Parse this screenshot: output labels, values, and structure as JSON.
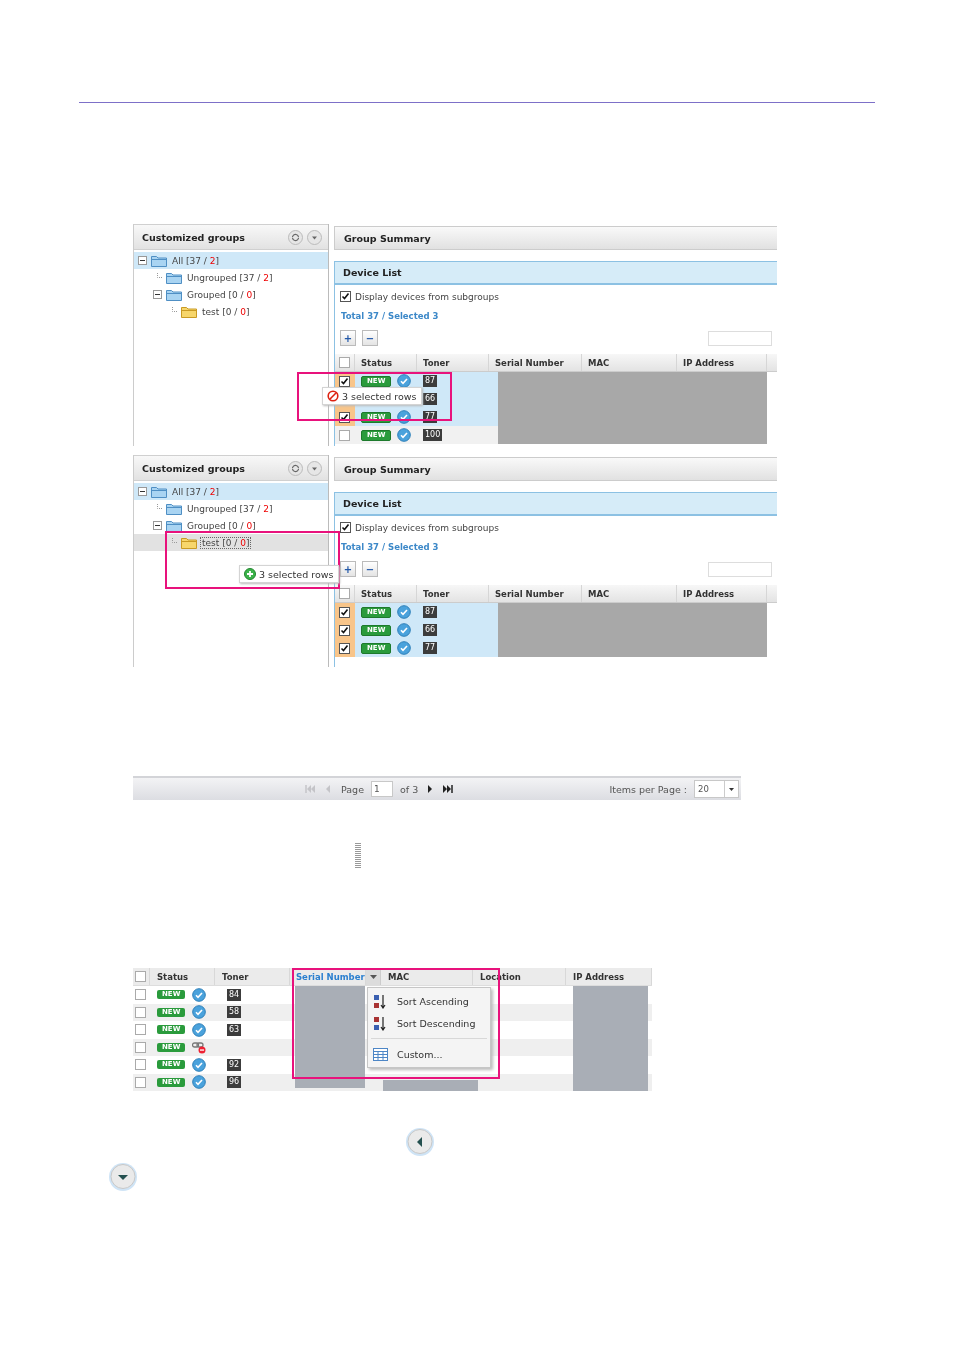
{
  "figures": [
    {
      "groups_title": "Customized groups",
      "tree": [
        {
          "text": "All [37 / ",
          "count": "2",
          "end": "]",
          "kind": "group",
          "selected": true,
          "drop_target": false,
          "expanded": true,
          "children": [
            {
              "text": "Ungrouped [37 / ",
              "count": "2",
              "end": "]",
              "kind": "group",
              "selected": false,
              "drop_target": false
            },
            {
              "text": "Grouped [0 / ",
              "count": "0",
              "end": "]",
              "kind": "group",
              "selected": false,
              "drop_target": false,
              "expanded": true,
              "children": [
                {
                  "text": "test [0 / ",
                  "count": "0",
                  "end": "]",
                  "kind": "leaf",
                  "selected": false,
                  "drop_target": false
                }
              ]
            }
          ]
        }
      ],
      "summary_title": "Group Summary",
      "list_title": "Device List",
      "subgroups": {
        "label": "Display devices from subgroups",
        "checked": true
      },
      "totals": "Total 37 / Selected 3",
      "toolbar": [
        "+",
        "−"
      ],
      "all_checked": false,
      "columns": [
        "Status",
        "Toner",
        "Serial Number",
        "MAC",
        "IP Address"
      ],
      "rows": [
        {
          "checked": true,
          "status": "NEW",
          "kind": "online",
          "toner": "87"
        },
        {
          "checked": true,
          "toner": "66"
        },
        {
          "checked": true,
          "status": "NEW",
          "kind": "online",
          "toner": "77"
        },
        {
          "checked": false,
          "status": "NEW",
          "kind": "online",
          "toner": "100"
        }
      ],
      "drag": {
        "text": "3 selected rows",
        "allowed": false
      }
    },
    {
      "groups_title": "Customized groups",
      "tree": [
        {
          "text": "All [37 / ",
          "count": "2",
          "end": "]",
          "kind": "group",
          "selected": true,
          "drop_target": false,
          "expanded": true,
          "children": [
            {
              "text": "Ungrouped [37 / ",
              "count": "2",
              "end": "]",
              "kind": "group",
              "selected": false,
              "drop_target": false
            },
            {
              "text": "Grouped [0 / ",
              "count": "0",
              "end": "]",
              "kind": "group",
              "selected": false,
              "drop_target": false,
              "expanded": true,
              "children": [
                {
                  "text": "test [0 / ",
                  "count": "0",
                  "end": "]",
                  "kind": "leaf",
                  "selected": false,
                  "drop_target": true
                }
              ]
            }
          ]
        }
      ],
      "summary_title": "Group Summary",
      "list_title": "Device List",
      "subgroups": {
        "label": "Display devices from subgroups",
        "checked": true
      },
      "totals": "Total 37 / Selected 3",
      "toolbar": [
        "+",
        "−"
      ],
      "all_checked": false,
      "columns": [
        "Status",
        "Toner",
        "Serial Number",
        "MAC",
        "IP Address"
      ],
      "rows": [
        {
          "checked": true,
          "status": "NEW",
          "kind": "online",
          "toner": "87"
        },
        {
          "checked": true,
          "status": "NEW",
          "kind": "online",
          "toner": "66"
        },
        {
          "checked": true,
          "status": "NEW",
          "kind": "online",
          "toner": "77"
        }
      ],
      "drag": {
        "text": "3 selected rows",
        "allowed": true
      }
    }
  ],
  "pager": {
    "nav_back": [
      {
        "kind": "first",
        "disabled": true
      },
      {
        "kind": "previous",
        "disabled": true
      }
    ],
    "page_label": "Page",
    "page_value": "1",
    "page_count": "of 3",
    "nav_forward": [
      {
        "kind": "next",
        "disabled": false
      },
      {
        "kind": "last",
        "disabled": false
      }
    ],
    "items_label": "Items per Page :",
    "items_value": "20"
  },
  "sort_grid": {
    "all_checked": false,
    "columns": [
      {
        "label": "Status",
        "selected": false
      },
      {
        "label": "Toner",
        "selected": false
      },
      {
        "label": "Serial Number",
        "selected": true
      },
      {
        "label": "MAC",
        "selected": false
      },
      {
        "label": "Location",
        "selected": false
      },
      {
        "label": "IP Address",
        "selected": false
      }
    ],
    "rows": [
      {
        "checked": false,
        "status": "NEW",
        "kind": "online",
        "toner": "84"
      },
      {
        "checked": false,
        "status": "NEW",
        "kind": "online",
        "toner": "58"
      },
      {
        "checked": false,
        "status": "NEW",
        "kind": "online",
        "toner": "63"
      },
      {
        "checked": false,
        "status": "NEW",
        "kind": "offline"
      },
      {
        "checked": false,
        "status": "NEW",
        "kind": "online",
        "toner": "92"
      },
      {
        "checked": false,
        "status": "NEW",
        "kind": "online",
        "toner": "96"
      }
    ],
    "menu": [
      {
        "kind": "sort-asc",
        "label": "Sort Ascending"
      },
      {
        "kind": "sort-desc",
        "label": "Sort Descending"
      },
      {
        "kind": "separator"
      },
      {
        "kind": "custom",
        "label": "Custom..."
      }
    ]
  },
  "round_buttons": [
    {
      "kind": "left"
    },
    {
      "kind": "down"
    }
  ]
}
